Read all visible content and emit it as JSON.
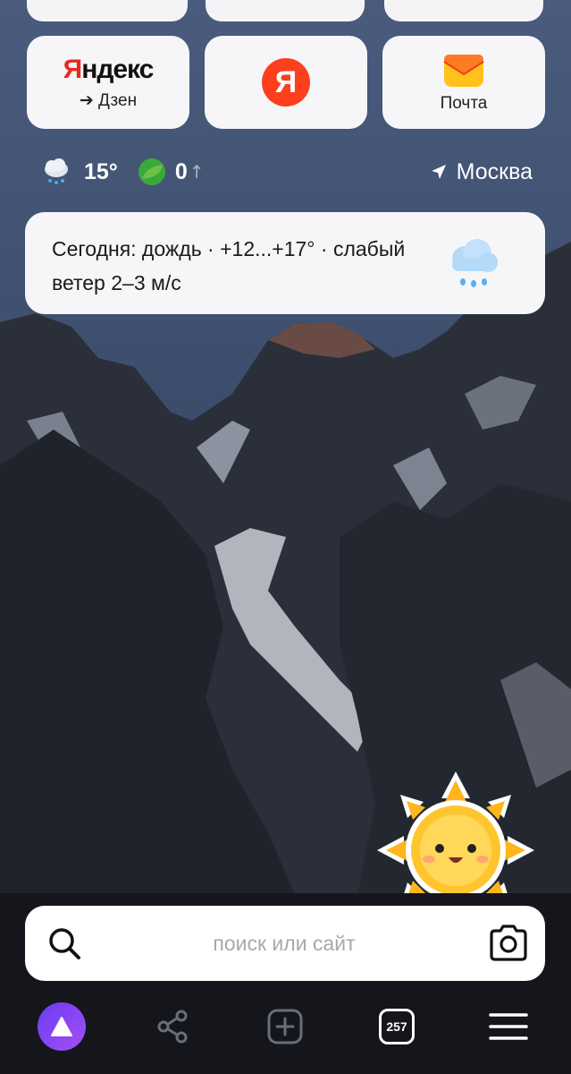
{
  "tiles": [
    {
      "logo": "Яндекс",
      "logo_first": "Я",
      "logo_rest": "ндекс",
      "label": "➔ Дзен",
      "icon": "yandex-logo"
    },
    {
      "logo": "Я",
      "label": "",
      "icon": "yandex-circle-icon"
    },
    {
      "logo": "",
      "label": "Почта",
      "icon": "mail-icon"
    }
  ],
  "status": {
    "temperature": "15°",
    "weather_icon": "rain-cloud-icon",
    "traffic_value": "0",
    "traffic_arrow": "↑",
    "city": "Москва",
    "location_icon": "location-arrow-icon"
  },
  "weather_card": {
    "text": "Сегодня: дождь · +12...+17° · слабый ветер 2–3 м/с",
    "icon": "rain-cloud-icon"
  },
  "search": {
    "placeholder": "поиск или сайт",
    "value": ""
  },
  "navbar": {
    "tabs_count": "257",
    "items": [
      "alice-button",
      "share-button",
      "new-tab-button",
      "tabs-button",
      "menu-button"
    ]
  },
  "colors": {
    "accent_red": "#fc3f1d",
    "alice_purple": "#8a45f3",
    "bottom_bar": "#14161c",
    "card_bg": "#f6f6f8"
  }
}
